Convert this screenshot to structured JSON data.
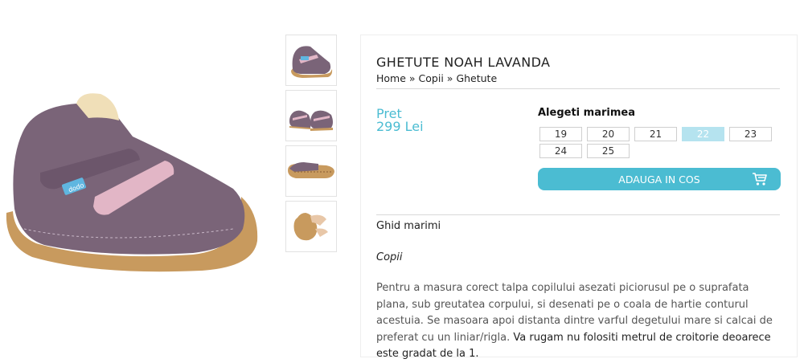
{
  "product": {
    "title": "GHETUTE NOAH LAVANDA",
    "breadcrumb": {
      "items": [
        "Home",
        "Copii",
        "Ghetute"
      ],
      "separator": "»"
    },
    "price_label": "Pret",
    "price_value": "299 Lei"
  },
  "sizes": {
    "heading": "Alegeti marimea",
    "options": [
      "19",
      "20",
      "21",
      "22",
      "23",
      "24",
      "25"
    ],
    "selected": "22"
  },
  "actions": {
    "add_to_cart": "ADAUGA IN COS",
    "cart_icon": "cart-icon"
  },
  "guide": {
    "title": "Ghid marimi",
    "subtitle": "Copii",
    "text_normal": "Pentru a masura corect talpa copilului asezati piciorusul pe o suprafata plana, sub greutatea corpului, si desenati pe o coala de hartie conturul acestuia. Se masoara apoi distanta dintre varful degetului mare si calcai de preferat cu un liniar/rigla.",
    "text_strong": "Va rugam nu folositi metrul de croitorie deoarece este gradat de la 1."
  },
  "images": {
    "main_brand_text": "dodo",
    "thumbnail_count": 4
  },
  "colors": {
    "accent": "#4bbcd2",
    "selected_size": "#b5e3ef",
    "shoe_leather": "#7a6478",
    "shoe_strap_pink": "#e2b6c6",
    "sole": "#c89a5e"
  }
}
